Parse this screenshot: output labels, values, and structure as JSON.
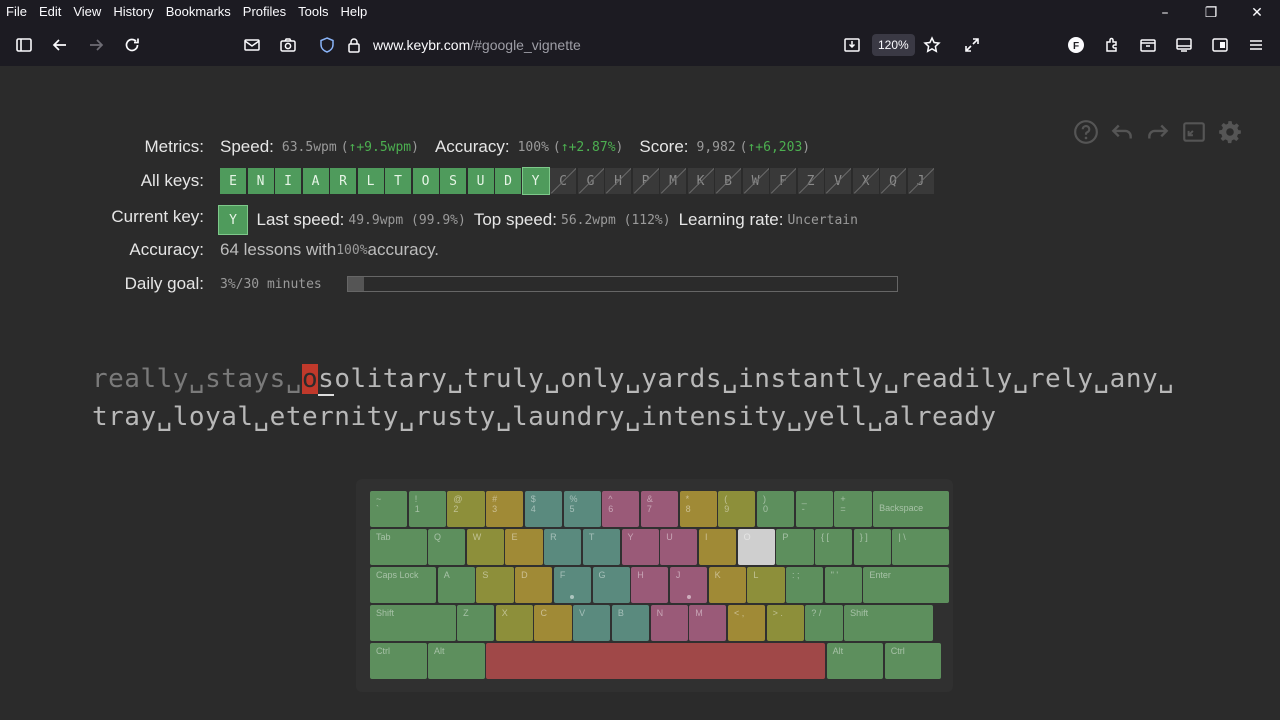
{
  "menu": [
    "File",
    "Edit",
    "View",
    "History",
    "Bookmarks",
    "Profiles",
    "Tools",
    "Help"
  ],
  "window_controls": {
    "minimize": "–",
    "restore": "❐",
    "close": "✕"
  },
  "browser": {
    "url_host": "www.keybr.com",
    "url_path": "/#google_vignette",
    "zoom": "120%"
  },
  "metrics": {
    "label": "Metrics:",
    "speed_label": "Speed:",
    "speed_value": "63.5wpm",
    "speed_delta": "↑+9.5wpm",
    "accuracy_label": "Accuracy:",
    "accuracy_value": "100%",
    "accuracy_delta": "↑+2.87%",
    "score_label": "Score:",
    "score_value": "9,982",
    "score_delta": "↑+6,203"
  },
  "all_keys": {
    "label": "All keys:",
    "included": [
      "E",
      "N",
      "I",
      "A",
      "R",
      "L",
      "T",
      "O",
      "S",
      "U",
      "D",
      "Y"
    ],
    "excluded": [
      "C",
      "G",
      "H",
      "P",
      "M",
      "K",
      "B",
      "W",
      "F",
      "Z",
      "V",
      "X",
      "Q",
      "J"
    ]
  },
  "current_key": {
    "label": "Current key:",
    "key": "Y",
    "last_speed_label": "Last speed:",
    "last_speed_value": "49.9wpm (99.9%)",
    "top_speed_label": "Top speed:",
    "top_speed_value": "56.2wpm (112%)",
    "learning_rate_label": "Learning rate:",
    "learning_rate_value": "Uncertain"
  },
  "accuracy_row": {
    "label": "Accuracy:",
    "text_a": "64 lessons with ",
    "text_b": "100%",
    "text_c": " accuracy."
  },
  "daily_goal": {
    "label": "Daily goal:",
    "value": "3%/30 minutes",
    "progress": 0.03
  },
  "lesson": {
    "line1_typed": "really␣stays␣",
    "line1_error": "o",
    "line1_cursor": "s",
    "line1_rest": "olitary␣truly␣only␣yards␣instantly␣readily␣rely␣any␣",
    "line2": "tray␣loyal␣eternity␣rusty␣laundry␣intensity␣yell␣already"
  },
  "keyboard": {
    "row1": [
      {
        "t": "~",
        "b": "`"
      },
      {
        "t": "!",
        "b": "1"
      },
      {
        "t": "@",
        "b": "2"
      },
      {
        "t": "#",
        "b": "3"
      },
      {
        "t": "$",
        "b": "4"
      },
      {
        "t": "%",
        "b": "5"
      },
      {
        "t": "^",
        "b": "6"
      },
      {
        "t": "&",
        "b": "7"
      },
      {
        "t": "*",
        "b": "8"
      },
      {
        "t": "(",
        "b": "9"
      },
      {
        "t": ")",
        "b": "0"
      },
      {
        "t": "_",
        "b": "-"
      },
      {
        "t": "+",
        "b": "="
      },
      {
        "t": "Backspace",
        "b": ""
      }
    ],
    "row2": [
      "Tab",
      "Q",
      "W",
      "E",
      "R",
      "T",
      "Y",
      "U",
      "I",
      "O",
      "P",
      "{ [",
      "} ]",
      "| \\"
    ],
    "row3": [
      "Caps Lock",
      "A",
      "S",
      "D",
      "F",
      "G",
      "H",
      "J",
      "K",
      "L",
      ": ;",
      "\" '",
      "Enter"
    ],
    "row4": [
      "Shift",
      "Z",
      "X",
      "C",
      "V",
      "B",
      "N",
      "M",
      "< ,",
      "> .",
      "? /",
      "Shift"
    ],
    "row5": [
      "Ctrl",
      "Alt",
      "",
      "Alt",
      "Ctrl"
    ],
    "colors": {
      "pinky": "#5d8f5d",
      "ring": "#8d8f3a",
      "middle": "#a08a36",
      "index_l": "#5a8a7e",
      "index_r": "#9a5a78",
      "space": "#a04848",
      "highlight": "#cfcfcf"
    }
  }
}
